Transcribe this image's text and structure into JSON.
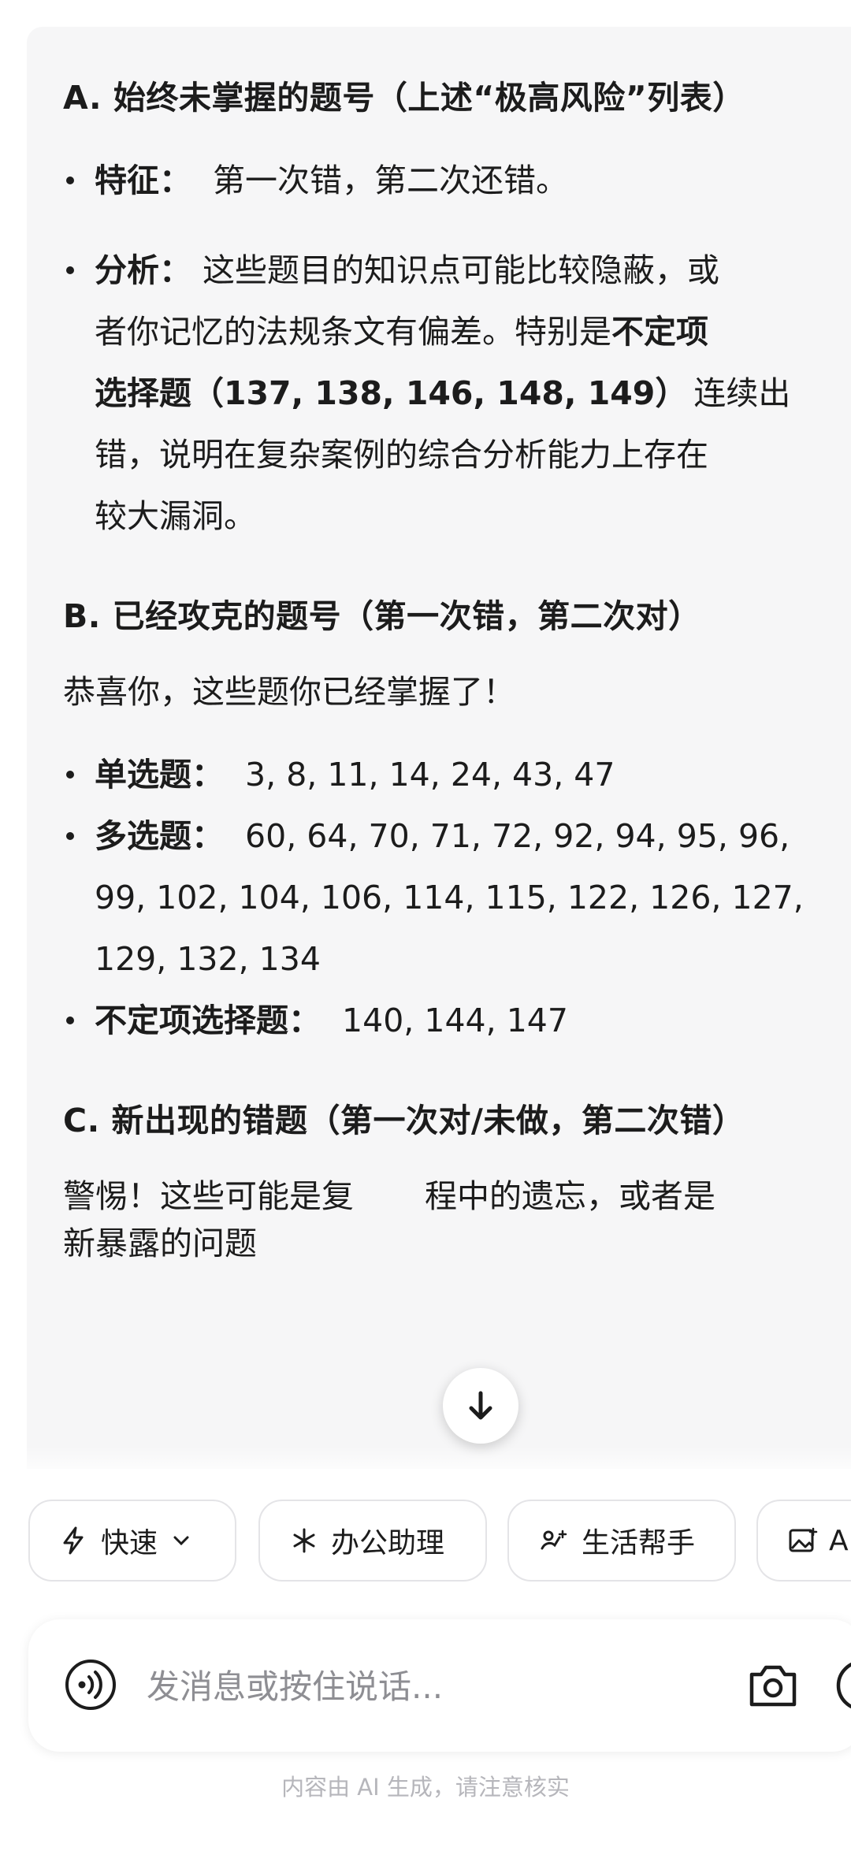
{
  "sections": [
    {
      "heading": "A. 始终未掌握的题号（上述“极高风险”列表）",
      "items": [
        {
          "label": "特征：",
          "lines": [
            "第一次错，第二次还错。"
          ]
        },
        {
          "label": "分析：",
          "lines": [
            "这些题目的知识点可能比较隐蔽，或",
            "者你记忆的法规条文有偏差。特别是",
            "选择题（137, 138, 146, 148, 149）连续出",
            "错，说明在复杂案例的综合分析能力上存在",
            "较大漏洞。"
          ],
          "bold_tail_line1": "不定项",
          "bold_head_line2": "选择题（137, 138, 146, 148, 149）",
          "line2_rest": "连续出",
          "line1_plain": "者你记忆的法规条文有偏差。特别是"
        }
      ]
    },
    {
      "heading": "B. 已经攻克的题号（第一次错，第二次对）",
      "intro": "恭喜你，这些题你已经掌握了！",
      "items": [
        {
          "label": "单选题：",
          "lines": [
            "3, 8, 11, 14, 24, 43, 47"
          ]
        },
        {
          "label": "多选题：",
          "lines": [
            "60, 64, 70, 71, 72, 92, 94, 95, 96,",
            "99, 102, 104, 106, 114, 115, 122, 126, 127,",
            "129, 132, 134"
          ]
        },
        {
          "label": "不定项选择题：",
          "lines": [
            "140, 144, 147"
          ]
        }
      ]
    },
    {
      "heading": "C. 新出现的错题（第一次对/未做，第二次错）",
      "intro_visible_left": "警惕！这些可能是复",
      "intro_visible_right": "程中的遗忘，或者是",
      "intro_line2": "新暴露的问题"
    }
  ],
  "chips": [
    {
      "label": "快速",
      "icon": "lightning-icon",
      "has_dropdown": true
    },
    {
      "label": "办公助理",
      "icon": "asterisk-icon"
    },
    {
      "label": "生活帮手",
      "icon": "life-helper-icon"
    },
    {
      "label": "A",
      "icon": "image-icon"
    }
  ],
  "input": {
    "placeholder": "发消息或按住说话..."
  },
  "disclaimer": "内容由 AI 生成，请注意核实",
  "colors": {
    "bubble_bg": "#f6f6f7",
    "text": "#1c1c1c",
    "placeholder": "#8e8e93",
    "disclaimer": "#b6b6bb"
  }
}
